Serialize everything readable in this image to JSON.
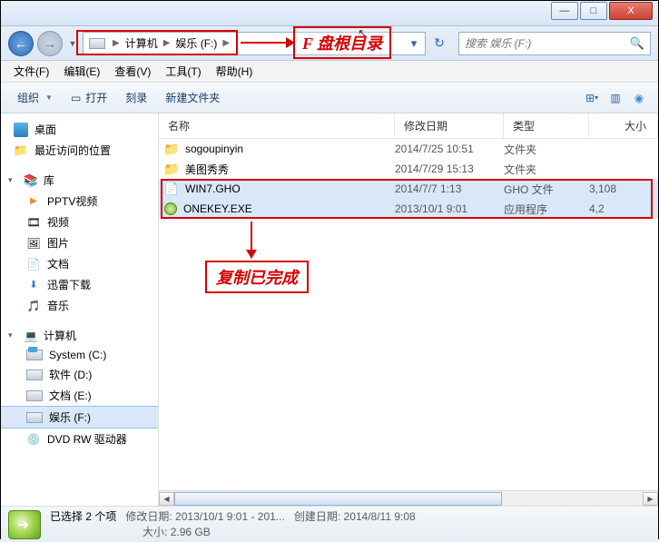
{
  "window": {
    "minimize": "—",
    "maximize": "□",
    "close": "X"
  },
  "address": {
    "crumb1": "计算机",
    "crumb2": "娱乐 (F:)",
    "refresh": "↻"
  },
  "search": {
    "placeholder": "搜索 娱乐 (F:)"
  },
  "menu": {
    "file": "文件(F)",
    "edit": "编辑(E)",
    "view": "查看(V)",
    "tools": "工具(T)",
    "help": "帮助(H)"
  },
  "toolbar": {
    "organize": "组织",
    "open": "打开",
    "burn": "刻录",
    "newfolder": "新建文件夹"
  },
  "nav": {
    "desktop": "桌面",
    "recent": "最近访问的位置",
    "library": "库",
    "pptv": "PPTV视频",
    "video": "视频",
    "pictures": "图片",
    "documents": "文档",
    "xunlei": "迅雷下载",
    "music": "音乐",
    "computer": "计算机",
    "drive_c": "System (C:)",
    "drive_d": "软件 (D:)",
    "drive_e": "文档 (E:)",
    "drive_f": "娱乐 (F:)",
    "dvd": "DVD RW 驱动器"
  },
  "columns": {
    "name": "名称",
    "date": "修改日期",
    "type": "类型",
    "size": "大小"
  },
  "files": [
    {
      "icon": "folder",
      "name": "sogoupinyin",
      "date": "2014/7/25 10:51",
      "type": "文件夹",
      "size": ""
    },
    {
      "icon": "folder",
      "name": "美图秀秀",
      "date": "2014/7/29 15:13",
      "type": "文件夹",
      "size": ""
    },
    {
      "icon": "file",
      "name": "WIN7.GHO",
      "date": "2014/7/7 1:13",
      "type": "GHO 文件",
      "size": "3,108",
      "sel": true
    },
    {
      "icon": "exe",
      "name": "ONEKEY.EXE",
      "date": "2013/10/1 9:01",
      "type": "应用程序",
      "size": "4,2",
      "sel": true
    }
  ],
  "status": {
    "title": "已选择 2 个项",
    "mod_label": "修改日期:",
    "mod_value": "2013/10/1 9:01 - 201...",
    "create_label": "创建日期:",
    "create_value": "2014/8/11 9:08",
    "size_label": "大小:",
    "size_value": "2.96 GB"
  },
  "annotations": {
    "label1": "F 盘根目录",
    "label2": "复制已完成"
  }
}
